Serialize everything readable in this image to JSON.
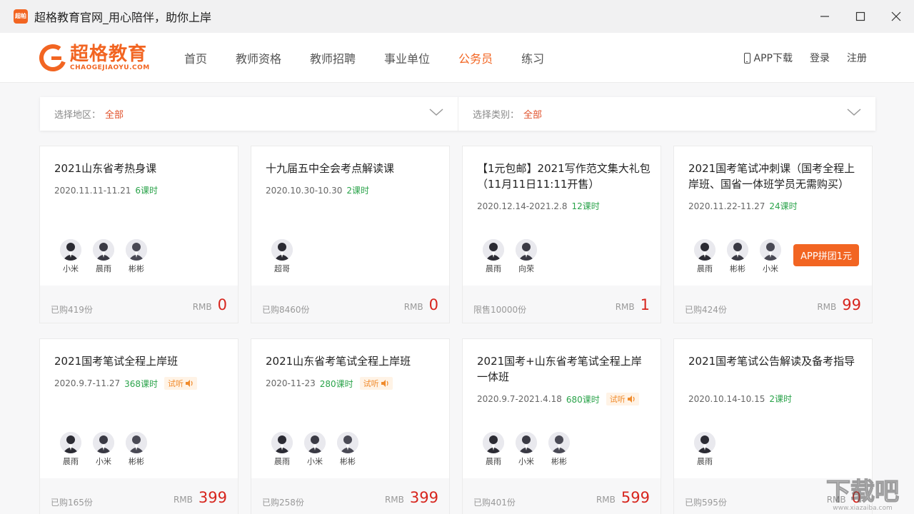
{
  "window": {
    "icon_text": "超帕",
    "title": "超格教育官网_用心陪伴，助你上岸"
  },
  "logo": {
    "cn": "超格教育",
    "en": "CHAOGEJIAOYU.COM"
  },
  "nav": {
    "links": [
      "首页",
      "教师资格",
      "教师招聘",
      "事业单位",
      "公务员",
      "练习"
    ],
    "active": "公务员",
    "app_download": "APP下载",
    "login": "登录",
    "register": "注册"
  },
  "filters": {
    "region_label": "选择地区：",
    "region_value": "全部",
    "category_label": "选择类别：",
    "category_value": "全部"
  },
  "labels": {
    "rmb": "RMB",
    "trial": "试听"
  },
  "cards": [
    {
      "title": "2021山东省考热身课",
      "date": "2020.11.11-11.21",
      "lessons": "6课时",
      "trial": false,
      "teachers": [
        "小米",
        "晨雨",
        "彬彬"
      ],
      "sold": "已购419份",
      "price": "0"
    },
    {
      "title": "十九届五中全会考点解读课",
      "date": "2020.10.30-10.30",
      "lessons": "2课时",
      "trial": false,
      "teachers": [
        "超哥"
      ],
      "sold": "已购8460份",
      "price": "0"
    },
    {
      "title": "【1元包邮】2021写作范文集大礼包（11月11日11:11开售）",
      "date": "2020.12.14-2021.2.8",
      "lessons": "12课时",
      "trial": false,
      "teachers": [
        "晨雨",
        "向荣"
      ],
      "sold": "限售10000份",
      "price": "1"
    },
    {
      "title": "2021国考笔试冲刺课（国考全程上岸班、国省一体班学员无需购买）",
      "date": "2020.11.22-11.27",
      "lessons": "24课时",
      "trial": false,
      "teachers": [
        "晨雨",
        "彬彬",
        "小米"
      ],
      "sold": "已购424份",
      "price": "99",
      "promo": "APP拼团1元"
    },
    {
      "title": "2021国考笔试全程上岸班",
      "date": "2020.9.7-11.27",
      "lessons": "368课时",
      "trial": true,
      "teachers": [
        "晨雨",
        "小米",
        "彬彬"
      ],
      "sold": "已购165份",
      "price": "399"
    },
    {
      "title": "2021山东省考笔试全程上岸班",
      "date": "2020-11-23",
      "lessons": "280课时",
      "trial": true,
      "teachers": [
        "晨雨",
        "小米",
        "彬彬"
      ],
      "sold": "已购258份",
      "price": "399"
    },
    {
      "title": "2021国考+山东省考笔试全程上岸一体班",
      "date": "2020.9.7-2021.4.18",
      "lessons": "680课时",
      "trial": true,
      "teachers": [
        "晨雨",
        "小米",
        "彬彬"
      ],
      "sold": "已购401份",
      "price": "599"
    },
    {
      "title": "2021国考笔试公告解读及备考指导",
      "date": "2020.10.14-10.15",
      "lessons": "2课时",
      "trial": false,
      "teachers": [
        "晨雨"
      ],
      "sold": "已购595份",
      "price": "0"
    }
  ],
  "colors": {
    "brand": "#f26522",
    "price": "#d7261e",
    "lessons": "#2aa34a",
    "trial": "#f08b2c"
  },
  "icons": [
    "app-logo-icon",
    "minimize-icon",
    "maximize-icon",
    "close-icon",
    "phone-icon",
    "chevron-down-icon",
    "speaker-icon",
    "avatar-photo"
  ]
}
